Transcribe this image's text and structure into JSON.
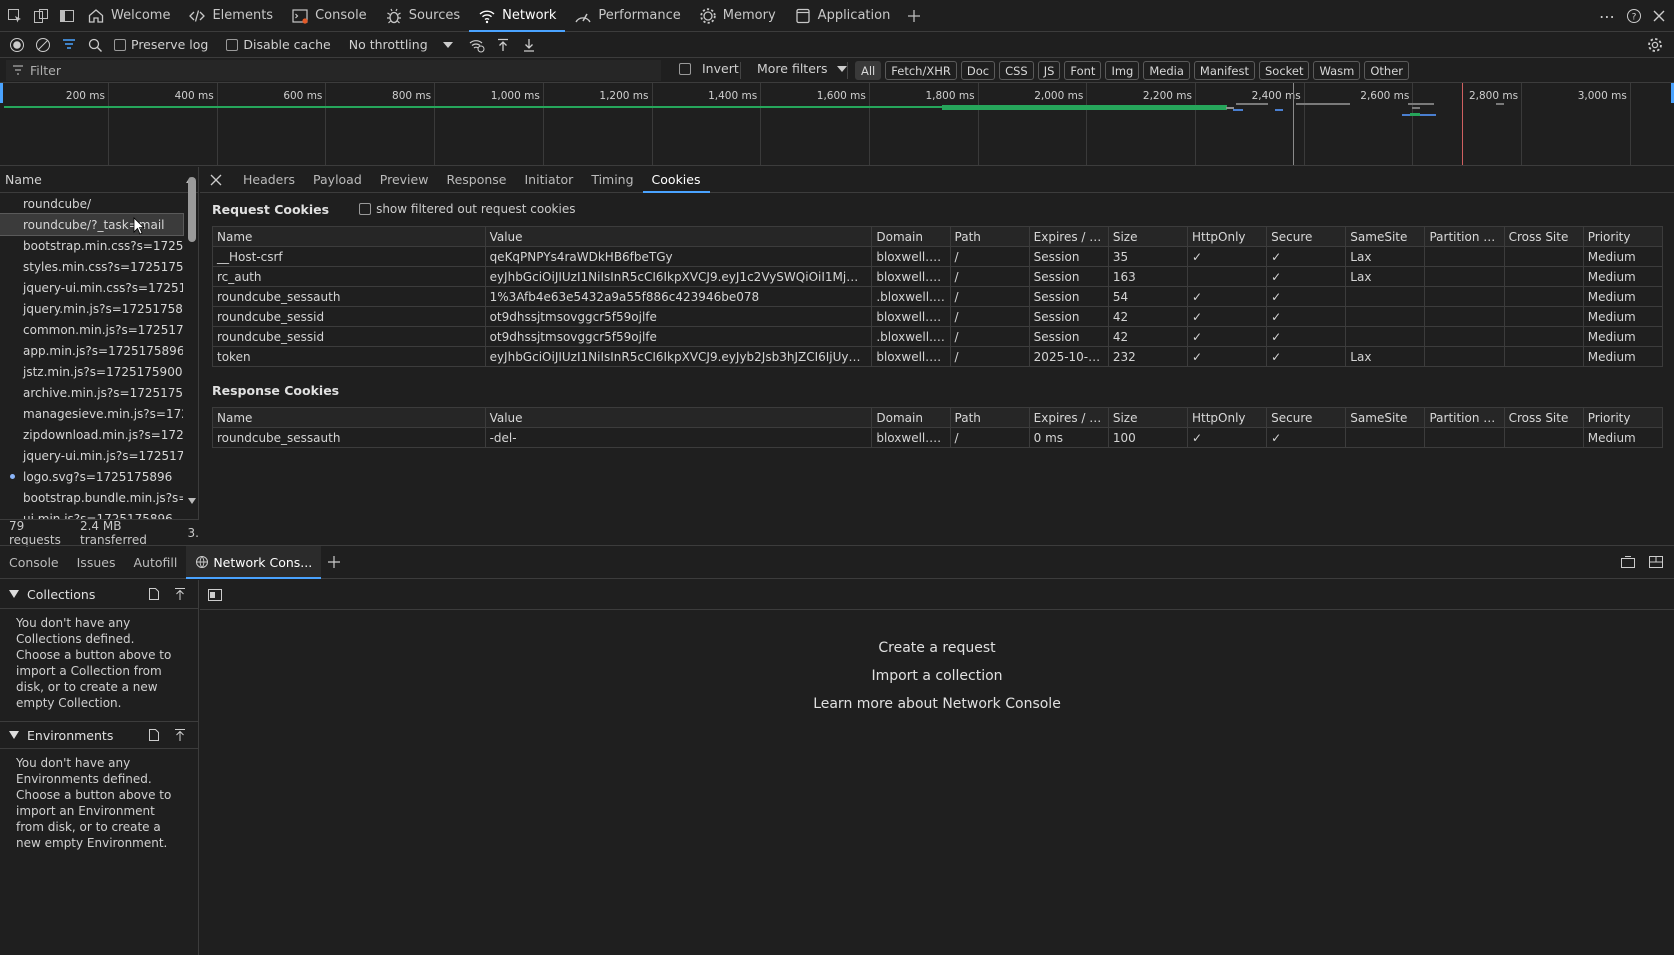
{
  "topbar": {
    "tabs": [
      {
        "label": "Welcome",
        "icon": "home-icon"
      },
      {
        "label": "Elements",
        "icon": "code-icon"
      },
      {
        "label": "Console",
        "icon": "console-icon"
      },
      {
        "label": "Sources",
        "icon": "bug-icon"
      },
      {
        "label": "Network",
        "icon": "wifi-icon",
        "active": true
      },
      {
        "label": "Performance",
        "icon": "performance-icon"
      },
      {
        "label": "Memory",
        "icon": "memory-icon"
      },
      {
        "label": "Application",
        "icon": "application-icon"
      }
    ]
  },
  "toolbar": {
    "preserve_log": "Preserve log",
    "disable_cache": "Disable cache",
    "throttling": "No throttling"
  },
  "filterbar": {
    "placeholder": "Filter",
    "invert": "Invert",
    "more_filters": "More filters",
    "types": [
      "All",
      "Fetch/XHR",
      "Doc",
      "CSS",
      "JS",
      "Font",
      "Img",
      "Media",
      "Manifest",
      "Socket",
      "Wasm",
      "Other"
    ],
    "selected_type": "All"
  },
  "overview": {
    "ticks": [
      "200 ms",
      "400 ms",
      "600 ms",
      "800 ms",
      "1,000 ms",
      "1,200 ms",
      "1,400 ms",
      "1,600 ms",
      "1,800 ms",
      "2,000 ms",
      "2,200 ms",
      "2,400 ms",
      "2,600 ms",
      "2,800 ms",
      "3,000 ms"
    ]
  },
  "requests": {
    "header": "Name",
    "items": [
      "roundcube/",
      "roundcube/?_task=mail",
      "bootstrap.min.css?s=1725175...",
      "styles.min.css?s=1725175896",
      "jquery-ui.min.css?s=172517...",
      "jquery.min.js?s=1725175899",
      "common.min.js?s=1725175...",
      "app.min.js?s=1725175896",
      "jstz.min.js?s=1725175900",
      "archive.min.js?s=1725175896",
      "managesieve.min.js?s=1725...",
      "zipdownload.min.js?s=1725...",
      "jquery-ui.min.js?s=1725175...",
      "logo.svg?s=1725175896",
      "bootstrap.bundle.min.js?s=...",
      "ui.min.js?s=1725175896"
    ],
    "selected_index": 1,
    "footer_requests": "79 requests",
    "footer_transferred": "2.4 MB transferred",
    "footer_extra": "3."
  },
  "details": {
    "tabs": [
      "Headers",
      "Payload",
      "Preview",
      "Response",
      "Initiator",
      "Timing",
      "Cookies"
    ],
    "active_tab": "Cookies",
    "request_cookies_title": "Request Cookies",
    "show_filtered": "show filtered out request cookies",
    "response_cookies_title": "Response Cookies",
    "columns": [
      "Name",
      "Value",
      "Domain",
      "Path",
      "Expires / M...",
      "Size",
      "HttpOnly",
      "Secure",
      "SameSite",
      "Partition Ke...",
      "Cross Site",
      "Priority"
    ],
    "request_cookies": [
      {
        "name": "__Host-csrf",
        "value": "qeKqPNPYs4raWDkHB6fbeTGy",
        "domain": "bloxwell.cl...",
        "path": "/",
        "expires": "Session",
        "size": "35",
        "httponly": "✓",
        "secure": "✓",
        "samesite": "Lax",
        "partition": "",
        "cross": "",
        "priority": "Medium"
      },
      {
        "name": "rc_auth",
        "value": "eyJhbGciOiJIUzI1NiIsInR5cCI6IkpXVCJ9.eyJ1c2VySWQiOiI1MjM0MTU...",
        "domain": "bloxwell.cl...",
        "path": "/",
        "expires": "Session",
        "size": "163",
        "httponly": "",
        "secure": "✓",
        "samesite": "Lax",
        "partition": "",
        "cross": "",
        "priority": "Medium"
      },
      {
        "name": "roundcube_sessauth",
        "value": "1%3Afb4e63e5432a9a55f886c423946be078",
        "domain": ".bloxwell.cl...",
        "path": "/",
        "expires": "Session",
        "size": "54",
        "httponly": "✓",
        "secure": "✓",
        "samesite": "",
        "partition": "",
        "cross": "",
        "priority": "Medium"
      },
      {
        "name": "roundcube_sessid",
        "value": "ot9dhssjtmsovggcr5f59ojlfe",
        "domain": "bloxwell.cl...",
        "path": "/",
        "expires": "Session",
        "size": "42",
        "httponly": "✓",
        "secure": "✓",
        "samesite": "",
        "partition": "",
        "cross": "",
        "priority": "Medium"
      },
      {
        "name": "roundcube_sessid",
        "value": "ot9dhssjtmsovggcr5f59ojlfe",
        "domain": ".bloxwell.cl...",
        "path": "/",
        "expires": "Session",
        "size": "42",
        "httponly": "✓",
        "secure": "✓",
        "samesite": "",
        "partition": "",
        "cross": "",
        "priority": "Medium"
      },
      {
        "name": "token",
        "value": "eyJhbGciOiJIUzI1NiIsInR5cCI6IkpXVCJ9.eyJyb2Jsb3hJZCI6IjUyMzQxNT...",
        "domain": "bloxwell.cl...",
        "path": "/",
        "expires": "2025-10-0...",
        "size": "232",
        "httponly": "✓",
        "secure": "✓",
        "samesite": "Lax",
        "partition": "",
        "cross": "",
        "priority": "Medium"
      }
    ],
    "response_cookies": [
      {
        "name": "roundcube_sessauth",
        "value": "-del-",
        "domain": "bloxwell.cl...",
        "path": "/",
        "expires": "0 ms",
        "size": "100",
        "httponly": "✓",
        "secure": "✓",
        "samesite": "",
        "partition": "",
        "cross": "",
        "priority": "Medium"
      }
    ]
  },
  "drawer": {
    "tabs": [
      "Console",
      "Issues",
      "Autofill",
      "Network Cons..."
    ],
    "active_tab": "Network Cons...",
    "collections_title": "Collections",
    "collections_desc": "You don't have any Collections defined. Choose a button above to import a Collection from disk, or to create a new empty Collection.",
    "environments_title": "Environments",
    "environments_desc": "You don't have any Environments defined. Choose a button above to import an Environment from disk, or to create a new empty Environment.",
    "create_request": "Create a request",
    "import_collection": "Import a collection",
    "learn_more": "Learn more about Network Console"
  },
  "colors": {
    "accent": "#4aa3ff",
    "waterfall_green": "#26a65b",
    "background": "#1f1f1f"
  }
}
